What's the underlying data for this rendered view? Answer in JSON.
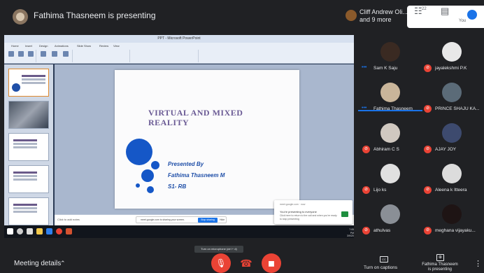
{
  "topbar": {
    "presenting_text": "Fathima Thasneem is presenting",
    "participants_line1": "Cliff Andrew Oli...",
    "participants_line2": "and 9 more",
    "people_count": "22",
    "you_label": "You"
  },
  "screen": {
    "ppt_window_title": "PPT - Microsoft PowerPoint",
    "ribbon_tabs": [
      "Home",
      "Insert",
      "Design",
      "Animations",
      "Slide Show",
      "Review",
      "View"
    ],
    "slide": {
      "title_line1": "VIRTUAL  AND MIXED",
      "title_line2": "REALITY",
      "presented_by": "Presented By",
      "presenter_name": "Fathima Thasneem M",
      "class": "S1- RB"
    },
    "notes_placeholder": "Click to add notes",
    "share_bar_text": "meet.google.com is sharing your screen.",
    "stop_sharing_label": "Stop sharing",
    "hide_label": "Hide",
    "popup_head": "meet.google.com · now",
    "popup_title": "You're presenting to everyone",
    "popup_sub": "Click here to return to the call and when you're ready to stop presenting",
    "clock_time": "7:05 PM",
    "clock_date": "3/9/2021"
  },
  "participants": [
    {
      "name": "Sam K Saju",
      "muted": false,
      "color": "#3a2a22"
    },
    {
      "name": "jayalekshmi P.K",
      "muted": true,
      "color": "#e8e8e8"
    },
    {
      "name": "Fathima Thasneem",
      "muted": false,
      "color": "#c9b59a"
    },
    {
      "name": "PRINCE SHAJU KA...",
      "muted": true,
      "color": "#5b6b78"
    },
    {
      "name": "Abhiram C S",
      "muted": true,
      "color": "#d0c8c0"
    },
    {
      "name": "AJAY JOY",
      "muted": true,
      "color": "#3d4a6e"
    },
    {
      "name": "Lijo ks",
      "muted": true,
      "color": "#e0e0e0"
    },
    {
      "name": "Aleena k Itteera",
      "muted": true,
      "color": "#dcdcdc"
    },
    {
      "name": "athulvas",
      "muted": true,
      "color": "#8a8f96"
    },
    {
      "name": "meghana vijayaku...",
      "muted": true,
      "color": "#1e1414"
    }
  ],
  "controls": {
    "meeting_details": "Meeting details",
    "tooltip": "Turn on microphone (ctrl + d)",
    "captions_icon": "CC",
    "captions_label": "Turn on captions",
    "present_label_line1": "Fathima Thasneem",
    "present_label_line2": "is presenting"
  },
  "colors": {
    "end_call": "#ffffff",
    "mic_off": "#ea4335",
    "cam_off": "#ea4335",
    "accent": "#1a73e8"
  }
}
